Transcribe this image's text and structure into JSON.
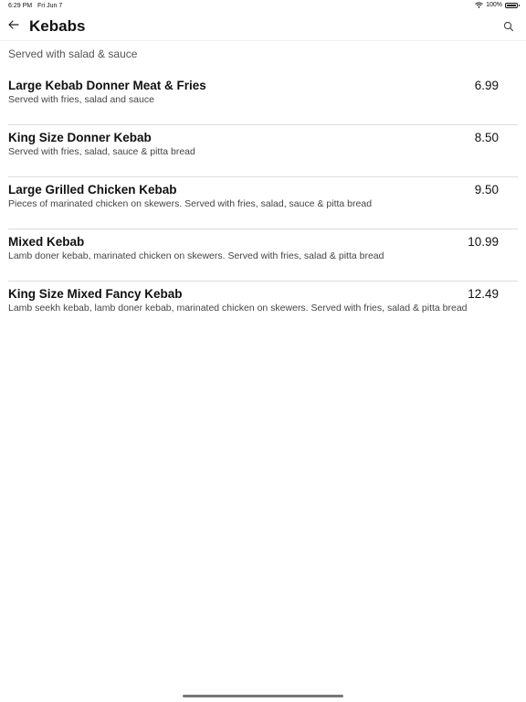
{
  "status": {
    "time": "6:29 PM",
    "date": "Fri Jun 7",
    "battery": "100%"
  },
  "header": {
    "title": "Kebabs",
    "back_icon": "arrow-left-icon",
    "search_icon": "search-icon"
  },
  "section": {
    "subtitle": "Served with salad & sauce"
  },
  "items": [
    {
      "name": "Large Kebab Donner Meat & Fries",
      "description": "Served with fries, salad and sauce",
      "price": "6.99"
    },
    {
      "name": "King Size Donner Kebab",
      "description": "Served with fries, salad, sauce & pitta bread",
      "price": "8.50"
    },
    {
      "name": "Large Grilled Chicken Kebab",
      "description": "Pieces of marinated chicken on skewers. Served with fries, salad, sauce & pitta bread",
      "price": "9.50"
    },
    {
      "name": "Mixed Kebab",
      "description": "Lamb doner kebab, marinated chicken on skewers. Served with fries, salad & pitta bread",
      "price": "10.99"
    },
    {
      "name": "King Size Mixed Fancy Kebab",
      "description": "Lamb seekh kebab, lamb doner kebab, marinated chicken on skewers. Served with fries, salad & pitta bread",
      "price": "12.49"
    }
  ]
}
